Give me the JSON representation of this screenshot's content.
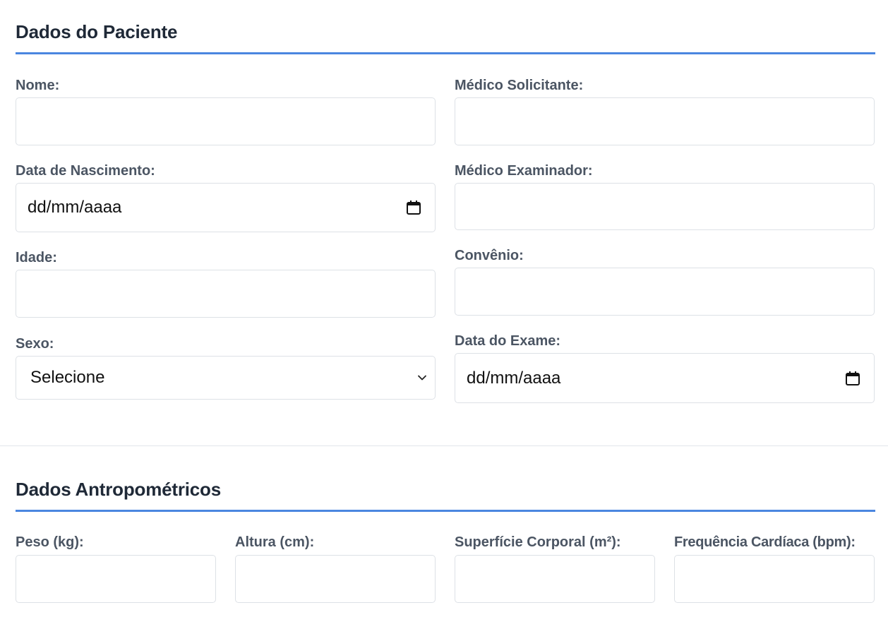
{
  "patient_section": {
    "title": "Dados do Paciente",
    "fields": {
      "nome": {
        "label": "Nome:",
        "value": ""
      },
      "medico_solicitante": {
        "label": "Médico Solicitante:",
        "value": ""
      },
      "data_nascimento": {
        "label": "Data de Nascimento:",
        "value": "dd/mm/aaaa",
        "icon": "calendar-icon"
      },
      "medico_examinador": {
        "label": "Médico Examinador:",
        "value": ""
      },
      "idade": {
        "label": "Idade:",
        "value": ""
      },
      "convenio": {
        "label": "Convênio:",
        "value": ""
      },
      "sexo": {
        "label": "Sexo:",
        "value": "Selecione",
        "icon": "chevron-down-icon"
      },
      "data_exame": {
        "label": "Data do Exame:",
        "value": "dd/mm/aaaa",
        "icon": "calendar-icon"
      }
    }
  },
  "anthropometric_section": {
    "title": "Dados Antropométricos",
    "fields": {
      "peso": {
        "label": "Peso (kg):",
        "value": ""
      },
      "altura": {
        "label": "Altura (cm):",
        "value": ""
      },
      "superficie_corporal": {
        "label": "Superfície Corporal (m²):",
        "value": ""
      },
      "frequencia_cardiaca": {
        "label": "Frequência Cardíaca (bpm):",
        "value": ""
      }
    }
  },
  "colors": {
    "accent": "#4a86e0",
    "heading": "#1f2937",
    "label": "#4b5563",
    "field_border": "#dde1e6",
    "divider": "#e2e5ea"
  }
}
